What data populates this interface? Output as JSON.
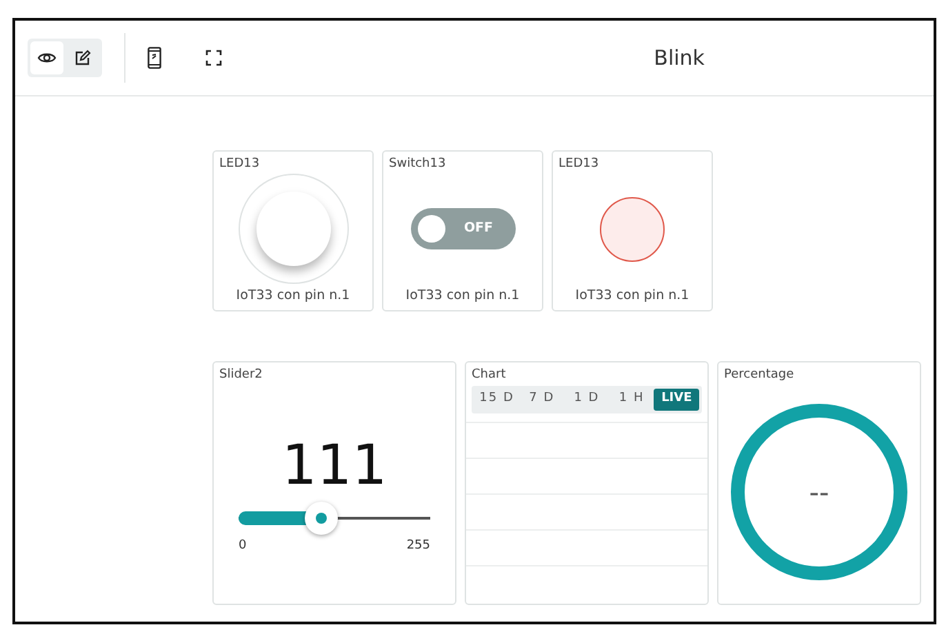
{
  "toolbar": {
    "modes": [
      {
        "kind": "view",
        "selected": true
      },
      {
        "kind": "edit",
        "selected": false
      }
    ],
    "title": "Blink"
  },
  "widgets": [
    {
      "kind": "button",
      "title": "LED13",
      "caption": "IoT33 con pin n.1",
      "on": false
    },
    {
      "kind": "switch",
      "title": "Switch13",
      "caption": "IoT33 con pin n.1",
      "on": false,
      "label": "OFF"
    },
    {
      "kind": "led",
      "title": "LED13",
      "caption": "IoT33 con pin n.1",
      "on": false
    },
    {
      "kind": "slider",
      "title": "Slider2",
      "value": "111",
      "level": 0.435,
      "min": "0",
      "max": "255"
    },
    {
      "kind": "chart",
      "title": "Chart",
      "ranges": [
        {
          "label": "15 D",
          "selected": false
        },
        {
          "label": "7 D",
          "selected": false
        },
        {
          "label": "1 D",
          "selected": false
        },
        {
          "label": "1 H",
          "selected": false
        },
        {
          "label": "LIVE",
          "selected": true
        }
      ]
    },
    {
      "kind": "gauge",
      "title": "Percentage",
      "reading": "--"
    }
  ]
}
